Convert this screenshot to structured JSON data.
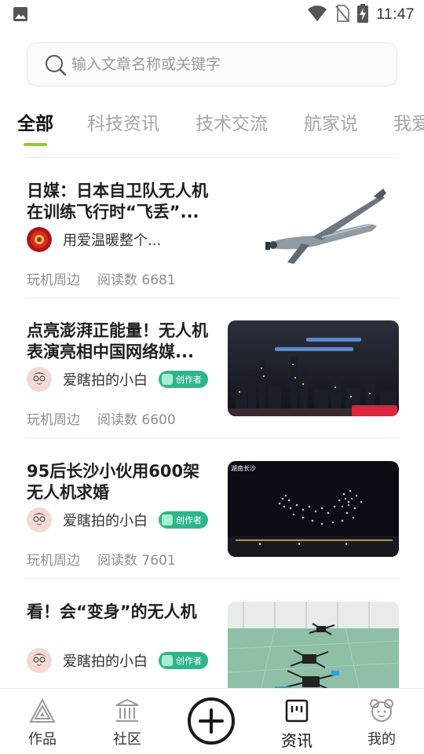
{
  "status_bar": {
    "time": "11:47",
    "icons": [
      "image-icon",
      "wifi-icon",
      "no-sim-icon",
      "battery-charging-icon"
    ]
  },
  "search": {
    "placeholder": "输入文章名称或关键字",
    "icon": "search-icon"
  },
  "tabs": [
    {
      "label": "全部",
      "active": true
    },
    {
      "label": "科技资讯",
      "active": false
    },
    {
      "label": "技术交流",
      "active": false
    },
    {
      "label": "航家说",
      "active": false
    },
    {
      "label": "我爱",
      "active": false
    }
  ],
  "articles": [
    {
      "title": "日媒：日本自卫队无人机在训练飞行时“飞丢”...",
      "author": "用爱温暖整个...",
      "creator_badge": "",
      "category": "玩机周边",
      "views": "阅读数 6681",
      "thumbnail": "drone-plane-image"
    },
    {
      "title": "点亮澎湃正能量！无人机表演亮相中国网络媒...",
      "author": "爱瞎拍的小白",
      "creator_badge": "创作者",
      "category": "玩机周边",
      "views": "阅读数 6600",
      "thumbnail": "city-night-drone-show-image"
    },
    {
      "title": "95后长沙小伙用600架无人机求婚",
      "author": "爱瞎拍的小白",
      "creator_badge": "创作者",
      "category": "玩机周边",
      "views": "阅读数 7601",
      "thumbnail": "drone-light-show-image",
      "thumbnail_caption": "湖南长沙"
    },
    {
      "title": "看！会“变身”的无人机",
      "author": "爱瞎拍的小白",
      "creator_badge": "创作者",
      "category": "",
      "views": "",
      "thumbnail": "quadcopter-drones-image"
    }
  ],
  "bottom_nav": [
    {
      "label": "作品",
      "icon": "triangle-icon",
      "active": false
    },
    {
      "label": "社区",
      "icon": "building-icon",
      "active": false
    },
    {
      "label": "",
      "icon": "add-circle-icon",
      "active": false
    },
    {
      "label": "资讯",
      "icon": "news-icon",
      "active": true
    },
    {
      "label": "我的",
      "icon": "profile-icon",
      "active": false
    }
  ],
  "colors": {
    "accent": "#8ccc3a",
    "creator_badge": "#2fb58a",
    "muted_text": "#8e8e8e",
    "tab_inactive": "#a6a6a6"
  }
}
